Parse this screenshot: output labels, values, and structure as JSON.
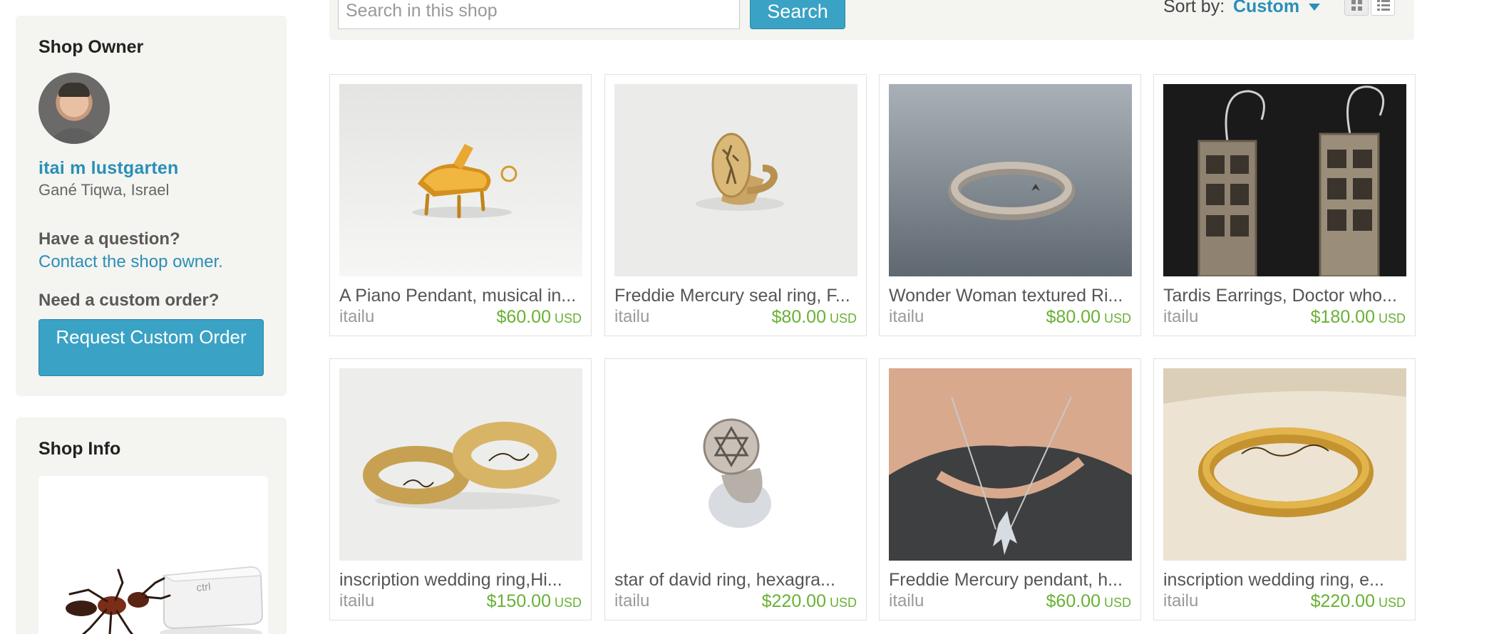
{
  "sidebar": {
    "owner_heading": "Shop Owner",
    "owner_name": "itai m lustgarten",
    "owner_location": "Gané Tiqwa, Israel",
    "question_label": "Have a question?",
    "contact_link": "Contact the shop owner.",
    "custom_label": "Need a custom order?",
    "custom_button": "Request Custom Order",
    "info_heading": "Shop Info",
    "info_card_text": "ctrl"
  },
  "toolbar": {
    "search_placeholder": "Search in this shop",
    "search_button": "Search",
    "sort_label": "Sort by:",
    "sort_value": "Custom"
  },
  "listings": [
    {
      "title": "A Piano Pendant, musical in...",
      "shop": "itailu",
      "price": "$60.00",
      "currency": "USD",
      "image": "piano-pendant"
    },
    {
      "title": "Freddie Mercury seal ring, F...",
      "shop": "itailu",
      "price": "$80.00",
      "currency": "USD",
      "image": "seal-ring"
    },
    {
      "title": "Wonder Woman textured Ri...",
      "shop": "itailu",
      "price": "$80.00",
      "currency": "USD",
      "image": "textured-ring"
    },
    {
      "title": "Tardis Earrings, Doctor who...",
      "shop": "itailu",
      "price": "$180.00",
      "currency": "USD",
      "image": "tardis-earrings"
    },
    {
      "title": "inscription wedding ring,Hi...",
      "shop": "itailu",
      "price": "$150.00",
      "currency": "USD",
      "image": "wedding-rings"
    },
    {
      "title": "star of david ring, hexagra...",
      "shop": "itailu",
      "price": "$220.00",
      "currency": "USD",
      "image": "star-ring"
    },
    {
      "title": "Freddie Mercury pendant, h...",
      "shop": "itailu",
      "price": "$60.00",
      "currency": "USD",
      "image": "mercury-pendant"
    },
    {
      "title": "inscription wedding ring, e...",
      "shop": "itailu",
      "price": "$220.00",
      "currency": "USD",
      "image": "gold-ring-box"
    }
  ],
  "colors": {
    "accent": "#3aa2c4",
    "link": "#2a8fb6",
    "price": "#68b133",
    "panel_bg": "#f4f4f1"
  }
}
